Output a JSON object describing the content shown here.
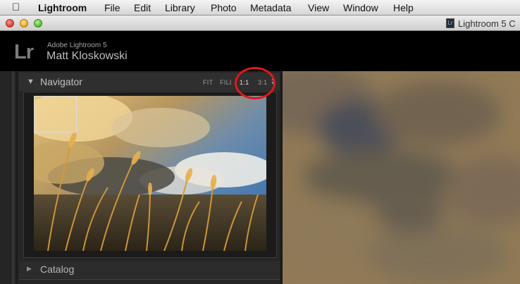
{
  "menu_bar": {
    "apple_icon": "apple-icon",
    "items": [
      "Lightroom",
      "File",
      "Edit",
      "Library",
      "Photo",
      "Metadata",
      "View",
      "Window",
      "Help"
    ]
  },
  "window": {
    "title": "Lightroom 5 C",
    "doc_icon_text": "Lr"
  },
  "identity_plate": {
    "logo": "Lr",
    "product": "Adobe Lightroom 5",
    "user": "Matt Kloskowski"
  },
  "navigator": {
    "title": "Navigator",
    "zoom_options": [
      "FIT",
      "FILL",
      "1:1",
      "3:1"
    ],
    "active_zoom": "1:1"
  },
  "catalog": {
    "title": "Catalog"
  },
  "colors": {
    "annotation": "#e0171c",
    "panel_bg": "#252525"
  }
}
